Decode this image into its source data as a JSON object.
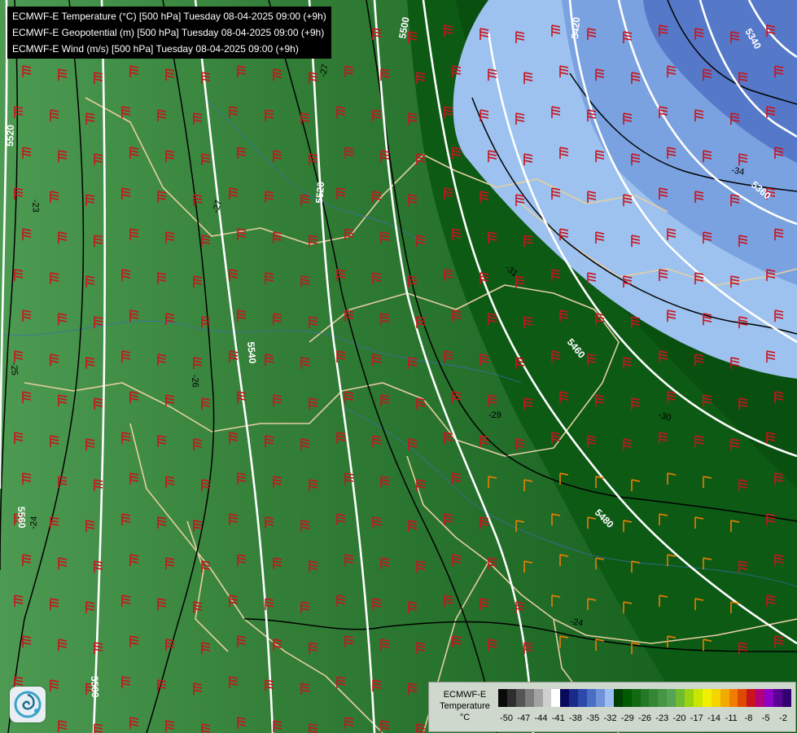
{
  "info": {
    "lines": [
      "ECMWF-E Temperature (°C) [500 hPa] Tuesday 08-04-2025 09:00 (+9h)",
      "ECMWF-E Geopotential (m) [500 hPa] Tuesday 08-04-2025 09:00 (+9h)",
      "ECMWF-E Wind (m/s) [500 hPa] Tuesday 08-04-2025 09:00 (+9h)"
    ]
  },
  "geopotential_labels": [
    "5520",
    "5500",
    "5420",
    "5340",
    "5520",
    "5540",
    "5360",
    "5460",
    "5480",
    "5560",
    "5580"
  ],
  "temperature_labels": [
    "-23",
    "-27",
    "-26",
    "-25",
    "-24",
    "-29",
    "-30",
    "-27",
    "-31",
    "-34",
    "-24"
  ],
  "legend": {
    "title": [
      "ECMWF-E",
      "Temperature",
      "°C"
    ],
    "ticks": [
      "-50",
      "-47",
      "-44",
      "-41",
      "-38",
      "-35",
      "-32",
      "-29",
      "-26",
      "-23",
      "-20",
      "-17",
      "-14",
      "-11",
      "-8",
      "-5",
      "-2"
    ],
    "colors": [
      "#0a0a0a",
      "#2e2e2e",
      "#555555",
      "#7c7c7c",
      "#a3a3a3",
      "#cfcfcf",
      "#ffffff",
      "#0a0a5a",
      "#1a2a8a",
      "#2d4aaa",
      "#4a6ec4",
      "#6f92d8",
      "#9dbef0",
      "#003f00",
      "#005a00",
      "#126912",
      "#237823",
      "#348634",
      "#449544",
      "#55a455",
      "#6fbb2f",
      "#9ad212",
      "#c8e600",
      "#f0f000",
      "#f5d400",
      "#f2a900",
      "#ef7d00",
      "#e04a00",
      "#c8141e",
      "#b4007a",
      "#8c00c8",
      "#5a0096",
      "#32006e"
    ]
  },
  "colors": {
    "warm_green": "#2f7a35",
    "dark_green": "#0a5a12",
    "cold_blue_light": "#9dc2ef",
    "cold_blue_mid": "#6f92d8",
    "cold_blue_deep": "#4a6cbf",
    "barb_red": "#c8141e",
    "barb_orange": "#ef7d00",
    "border_tan": "#e6cfa0",
    "contour_white": "#ffffff",
    "contour_black": "#000000"
  },
  "logo": "ecmwf-swirl-logo"
}
